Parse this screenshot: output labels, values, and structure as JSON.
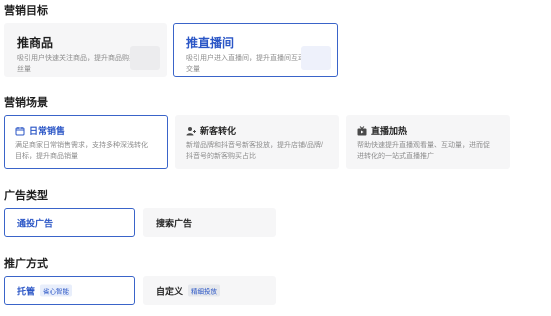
{
  "sections": {
    "goal": "营销目标",
    "scene": "营销场景",
    "adtype": "广告类型",
    "method": "推广方式"
  },
  "goals": [
    {
      "title": "推商品",
      "desc": "吸引用户快速关注商品，提升商品购买量和粉丝量",
      "selected": false
    },
    {
      "title": "推直播间",
      "desc": "吸引用户进入直播间，提升直播间互动量和成交量",
      "selected": true
    }
  ],
  "scenes": [
    {
      "title": "日常销售",
      "icon": "calendar-icon",
      "desc": "满足商家日常销售需求，支持多种深浅转化目标，提升商品销量",
      "selected": true
    },
    {
      "title": "新客转化",
      "icon": "user-add-icon",
      "desc": "新增品牌和抖音号新客投放，提升店铺/品牌/抖音号的新客购买占比",
      "selected": false
    },
    {
      "title": "直播加热",
      "icon": "live-icon",
      "desc": "帮助快速提升直播观看量、互动量，进而促进转化的一站式直播推广",
      "selected": false
    }
  ],
  "adtypes": [
    {
      "label": "通投广告",
      "selected": true
    },
    {
      "label": "搜索广告",
      "selected": false
    }
  ],
  "methods": [
    {
      "label": "托管",
      "tag": "省心智能",
      "selected": true
    },
    {
      "label": "自定义",
      "tag": "精细投放",
      "selected": false
    }
  ],
  "colors": {
    "accent": "#2b56c6",
    "border_selected": "#3a64c9",
    "card_bg": "#f6f6f7"
  }
}
